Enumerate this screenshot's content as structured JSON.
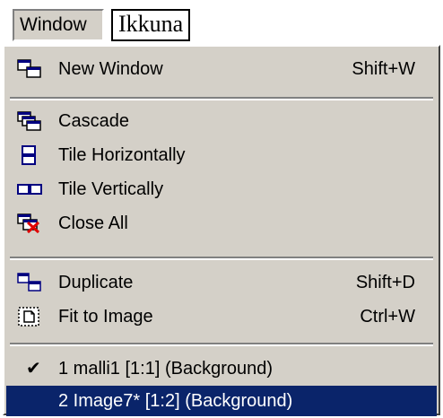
{
  "menubar": {
    "title": "Window",
    "caption": "Ikkuna"
  },
  "menu": {
    "items": [
      {
        "label": "New Window",
        "shortcut": "Shift+W",
        "icon": "new-window-icon"
      },
      {
        "label": "Cascade",
        "icon": "cascade-icon"
      },
      {
        "label": "Tile Horizontally",
        "icon": "tile-horizontal-icon"
      },
      {
        "label": "Tile Vertically",
        "icon": "tile-vertical-icon"
      },
      {
        "label": "Close All",
        "icon": "close-all-icon"
      },
      {
        "label": "Duplicate",
        "shortcut": "Shift+D",
        "icon": "duplicate-icon"
      },
      {
        "label": "Fit to Image",
        "shortcut": "Ctrl+W",
        "icon": "fit-to-image-icon"
      },
      {
        "label": "1 malli1 [1:1] (Background)",
        "checked": true
      },
      {
        "label": "2 Image7* [1:2] (Background)",
        "highlighted": true
      }
    ],
    "check_mark": "✔"
  },
  "colors": {
    "menu_bg": "#d4d0c8",
    "highlight": "#0a246a",
    "highlight_text": "#ffffff"
  }
}
